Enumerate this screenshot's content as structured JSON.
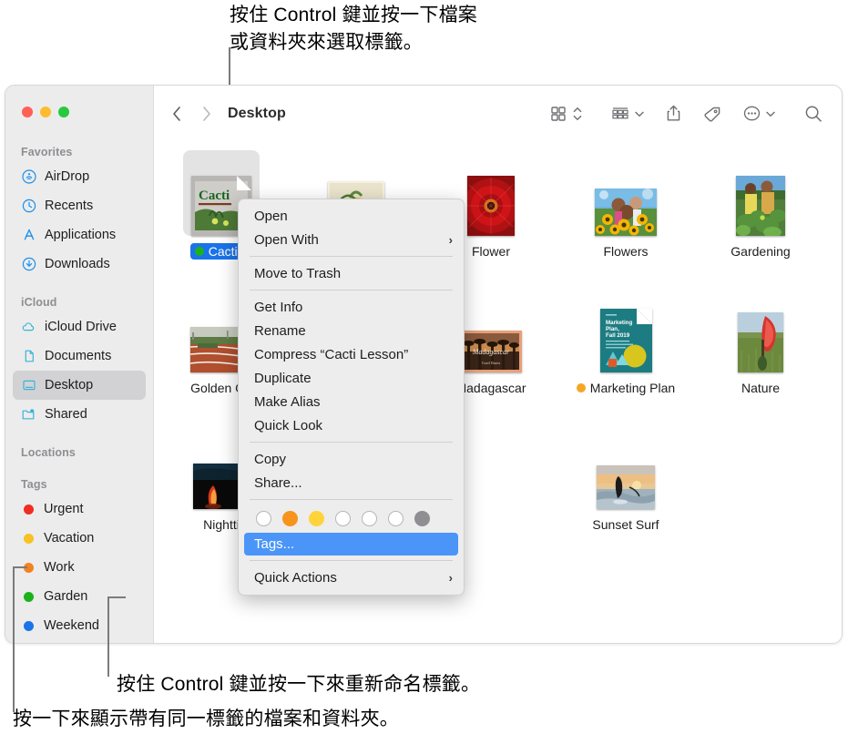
{
  "annotations": {
    "top_line1": "按住 Control 鍵並按一下檔案",
    "top_line2": "或資料夾來選取標籤。",
    "bottom_line1": "按住 Control 鍵並按一下來重新命名標籤。",
    "bottom_line2": "按一下來顯示帶有同一標籤的檔案和資料夾。"
  },
  "window": {
    "title": "Desktop",
    "traffic_lights": [
      "close",
      "minimize",
      "zoom"
    ]
  },
  "toolbar": {
    "back_label": "‹",
    "forward_label": "›",
    "buttons": [
      {
        "name": "icon-view-button",
        "icon": "grid-view-icon"
      },
      {
        "name": "view-stepper-button",
        "icon": "chevron-up-down-icon"
      },
      {
        "name": "group-by-button",
        "icon": "group-list-icon"
      },
      {
        "name": "group-by-chevron",
        "icon": "chevron-down-icon"
      },
      {
        "name": "share-button",
        "icon": "share-icon"
      },
      {
        "name": "tag-button",
        "icon": "tag-icon"
      },
      {
        "name": "more-actions-button",
        "icon": "ellipsis-circle-icon"
      },
      {
        "name": "more-actions-chevron",
        "icon": "chevron-down-icon"
      },
      {
        "name": "search-button",
        "icon": "search-icon"
      }
    ]
  },
  "sidebar": {
    "sections": [
      {
        "header": "Favorites",
        "items": [
          {
            "label": "AirDrop",
            "icon": "airdrop-icon",
            "selected": false
          },
          {
            "label": "Recents",
            "icon": "clock-icon",
            "selected": false
          },
          {
            "label": "Applications",
            "icon": "applications-icon",
            "selected": false
          },
          {
            "label": "Downloads",
            "icon": "download-icon",
            "selected": false
          }
        ]
      },
      {
        "header": "iCloud",
        "items": [
          {
            "label": "iCloud Drive",
            "icon": "cloud-icon",
            "selected": false
          },
          {
            "label": "Documents",
            "icon": "document-icon",
            "selected": false
          },
          {
            "label": "Desktop",
            "icon": "desktop-icon",
            "selected": true
          },
          {
            "label": "Shared",
            "icon": "shared-folder-icon",
            "selected": false
          }
        ]
      },
      {
        "header": "Locations",
        "items": []
      },
      {
        "header": "Tags",
        "items": [
          {
            "label": "Urgent",
            "color": "#ef2d23",
            "selected": false
          },
          {
            "label": "Vacation",
            "color": "#f7c223",
            "selected": false
          },
          {
            "label": "Work",
            "color": "#f58220",
            "selected": false
          },
          {
            "label": "Garden",
            "color": "#1bb21b",
            "selected": false
          },
          {
            "label": "Weekend",
            "color": "#1a73e8",
            "selected": false
          }
        ]
      }
    ]
  },
  "files": {
    "rows": [
      [
        {
          "name": "Cacti L",
          "type": "document",
          "selected": true,
          "tag_color": "#1bb21b"
        },
        {
          "name": "",
          "type": "photo-district",
          "selected": false,
          "tag_color": null
        },
        {
          "name": "Flower",
          "type": "photo-red-flower",
          "selected": false,
          "tag_color": null
        },
        {
          "name": "Flowers",
          "type": "photo-sunflowers",
          "selected": false,
          "tag_color": null
        },
        {
          "name": "Gardening",
          "type": "photo-gardening",
          "selected": false,
          "tag_color": null
        }
      ],
      [
        {
          "name": "Golden Ga",
          "type": "photo-track",
          "selected": false,
          "tag_color": null
        },
        {
          "name": "",
          "type": "hidden",
          "selected": false,
          "tag_color": null
        },
        {
          "name": "Madagascar",
          "type": "photo-madagascar",
          "selected": false,
          "tag_color": null
        },
        {
          "name": "Marketing Plan",
          "type": "document-teal",
          "selected": false,
          "tag_color": "#f5a623"
        },
        {
          "name": "Nature",
          "type": "photo-nature",
          "selected": false,
          "tag_color": null
        }
      ],
      [
        {
          "name": "Nightti",
          "type": "photo-night",
          "selected": false,
          "tag_color": null
        },
        {
          "name": "",
          "type": "hidden",
          "selected": false,
          "tag_color": null
        },
        {
          "name": "",
          "type": "hidden",
          "selected": false,
          "tag_color": null
        },
        {
          "name": "Sunset Surf",
          "type": "photo-surf",
          "selected": false,
          "tag_color": null
        },
        {
          "name": "",
          "type": "hidden",
          "selected": false,
          "tag_color": null
        }
      ]
    ]
  },
  "context_menu": {
    "groups": [
      [
        {
          "label": "Open",
          "submenu": false,
          "highlighted": false
        },
        {
          "label": "Open With",
          "submenu": true,
          "highlighted": false
        }
      ],
      [
        {
          "label": "Move to Trash",
          "submenu": false,
          "highlighted": false
        }
      ],
      [
        {
          "label": "Get Info",
          "submenu": false,
          "highlighted": false
        },
        {
          "label": "Rename",
          "submenu": false,
          "highlighted": false
        },
        {
          "label": "Compress “Cacti Lesson”",
          "submenu": false,
          "highlighted": false
        },
        {
          "label": "Duplicate",
          "submenu": false,
          "highlighted": false
        },
        {
          "label": "Make Alias",
          "submenu": false,
          "highlighted": false
        },
        {
          "label": "Quick Look",
          "submenu": false,
          "highlighted": false
        }
      ],
      [
        {
          "label": "Copy",
          "submenu": false,
          "highlighted": false
        },
        {
          "label": "Share...",
          "submenu": false,
          "highlighted": false
        }
      ]
    ],
    "tag_swatches": [
      {
        "color": null,
        "filled": false
      },
      {
        "color": "#f7941d",
        "filled": true
      },
      {
        "color": "#ffd43b",
        "filled": true
      },
      {
        "color": null,
        "filled": false
      },
      {
        "color": null,
        "filled": false
      },
      {
        "color": null,
        "filled": false
      },
      {
        "color": "#8e8e93",
        "filled": true
      }
    ],
    "tags_item": {
      "label": "Tags...",
      "highlighted": true
    },
    "quick_actions": {
      "label": "Quick Actions",
      "submenu": true
    }
  },
  "colors": {
    "selection_blue": "#1a73e8",
    "menu_highlight": "#4a95f7",
    "sidebar_bg": "#ececec",
    "menu_bg": "#ededed"
  }
}
